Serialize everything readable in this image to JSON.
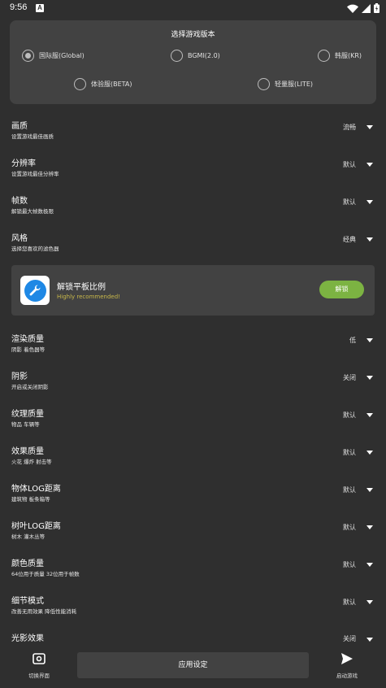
{
  "status": {
    "time": "9:56",
    "app_badge": "A"
  },
  "version": {
    "title": "选择游戏版本",
    "options": [
      {
        "label": "国际服(Global)",
        "selected": true
      },
      {
        "label": "BGMI(2.0)",
        "selected": false
      },
      {
        "label": "韩服(KR)",
        "selected": false
      },
      {
        "label": "体验服(BETA)",
        "selected": false
      },
      {
        "label": "轻量服(LITE)",
        "selected": false
      }
    ]
  },
  "settings": [
    {
      "title": "画质",
      "desc": "设置游戏最佳画质",
      "value": "流畅"
    },
    {
      "title": "分辨率",
      "desc": "设置游戏最佳分辨率",
      "value": "默认"
    },
    {
      "title": "帧数",
      "desc": "解锁最大帧数极限",
      "value": "默认"
    },
    {
      "title": "风格",
      "desc": "选择您喜欢的滤色器",
      "value": "经典"
    },
    {
      "title": "渲染质量",
      "desc": "阴影 着色器等",
      "value": "低"
    },
    {
      "title": "阴影",
      "desc": "开启或关闭阴影",
      "value": "关闭"
    },
    {
      "title": "纹理质量",
      "desc": "物品 车辆等",
      "value": "默认"
    },
    {
      "title": "效果质量",
      "desc": "火花 爆炸 射击等",
      "value": "默认"
    },
    {
      "title": "物体LOG距离",
      "desc": "建筑物 板条箱等",
      "value": "默认"
    },
    {
      "title": "树叶LOG距离",
      "desc": "树木 灌木丛等",
      "value": "默认"
    },
    {
      "title": "颜色质量",
      "desc": "64位用于质量 32位用于帧数",
      "value": "默认"
    },
    {
      "title": "细节模式",
      "desc": "改善无用效果 降低性能消耗",
      "value": "默认"
    },
    {
      "title": "光影效果",
      "desc": "",
      "value": "关闭"
    }
  ],
  "unlock": {
    "title": "解锁平板比例",
    "subtitle": "Highly recommended!",
    "button": "解锁",
    "icon": "wrench-icon"
  },
  "bottom": {
    "left_label": "切换界面",
    "apply_label": "应用设定",
    "right_label": "启动游戏"
  },
  "colors": {
    "background": "#2f2f2f",
    "card": "#424242",
    "accent_green": "#7cb342",
    "accent_blue": "#1e88e5",
    "subtitle_yellow": "#c8b84a"
  }
}
